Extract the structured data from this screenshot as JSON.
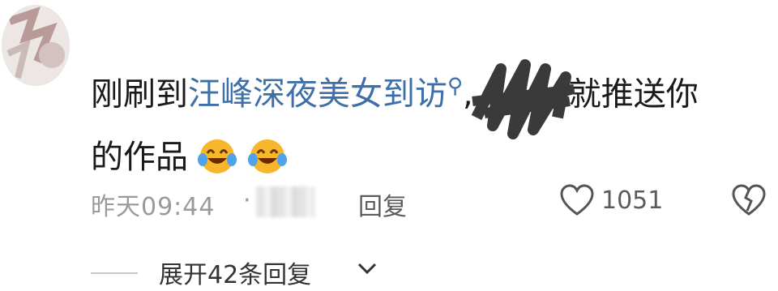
{
  "comment": {
    "prefix": "刚刷到",
    "topic": "汪峰深夜美女到访",
    "topic_icon": "search-icon",
    "comma": ",",
    "suffix": "就推送你",
    "line2": "的作品",
    "emojis": [
      "laugh-cry-emoji",
      "laugh-cry-emoji"
    ]
  },
  "meta": {
    "time": "昨天09:44",
    "dot": "·",
    "reply_label": "回复",
    "like_count": "1051"
  },
  "expand": {
    "label": "展开42条回复"
  },
  "colors": {
    "topic": "#3e6fa8",
    "meta_text": "#9a9a9a"
  }
}
